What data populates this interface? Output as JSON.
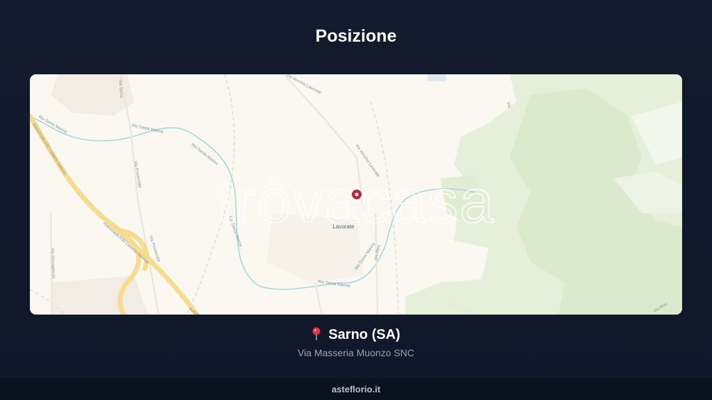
{
  "page": {
    "title": "Posizione"
  },
  "map": {
    "watermark": "trôvacasa",
    "place_label": "Lavorate",
    "road_labels": {
      "autostrada_1": "Autostrada A30 Caserta-Salerno",
      "autostrada_2": "Autostrada A30 Caserta-Salerno",
      "autostrada_3": "Autostr",
      "via_provinciale_1": "Via Provinciale",
      "via_provinciale_2": "Via Provinciale",
      "via_zeccagnuolo": "Via Zeccagnuolo",
      "via_vecchia_lavorate_1": "Via Vecchia Lavorate",
      "via_vecchia_lavorate_2": "Via Vecchia Lavorate",
      "rio_santa_marina_1": "Rio Santa Marina",
      "rio_santa_marina_2": "Rio Santa Marina",
      "rio_santa_marina_3": "Rio Santa Marina",
      "rio_santa_marina_4": "Rio Santa Marina",
      "rio_santa_marina_5": "Rio Santa Marina",
      "rio_santa_marina_6": "Rio Santa Marina",
      "via_rivo": "Via Rivo",
      "via_right": "Via",
      "via_top": "Via Sarno",
      "corner_label": "Via Rivo"
    },
    "colors": {
      "land": "#fbf7f1",
      "park": "#e4efd6",
      "highway": "#f6dc8e",
      "river": "#a9d4dc",
      "marker": "#c22035"
    }
  },
  "location": {
    "pin_icon": "round-pushpin",
    "city": "Sarno (SA)",
    "address": "Via Masseria Muonzo SNC"
  },
  "footer": {
    "site": "asteflorio.it"
  }
}
